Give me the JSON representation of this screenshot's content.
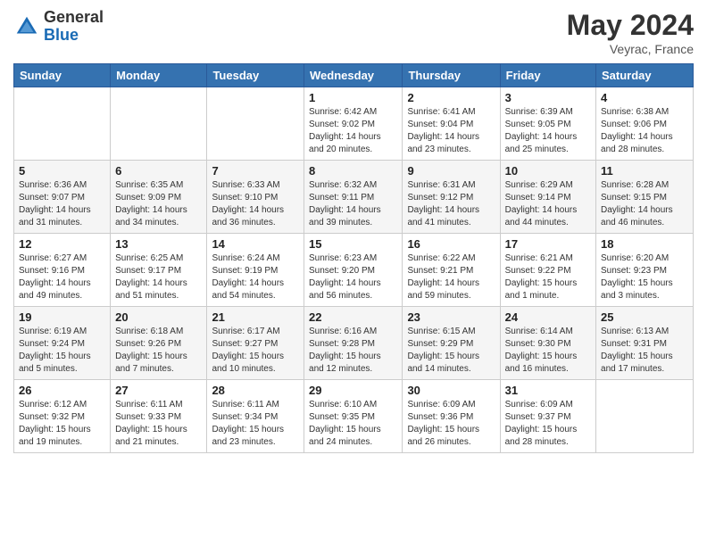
{
  "logo": {
    "general": "General",
    "blue": "Blue"
  },
  "title": {
    "month": "May 2024",
    "location": "Veyrac, France"
  },
  "days_of_week": [
    "Sunday",
    "Monday",
    "Tuesday",
    "Wednesday",
    "Thursday",
    "Friday",
    "Saturday"
  ],
  "weeks": [
    [
      {
        "day": "",
        "info": ""
      },
      {
        "day": "",
        "info": ""
      },
      {
        "day": "",
        "info": ""
      },
      {
        "day": "1",
        "info": "Sunrise: 6:42 AM\nSunset: 9:02 PM\nDaylight: 14 hours\nand 20 minutes."
      },
      {
        "day": "2",
        "info": "Sunrise: 6:41 AM\nSunset: 9:04 PM\nDaylight: 14 hours\nand 23 minutes."
      },
      {
        "day": "3",
        "info": "Sunrise: 6:39 AM\nSunset: 9:05 PM\nDaylight: 14 hours\nand 25 minutes."
      },
      {
        "day": "4",
        "info": "Sunrise: 6:38 AM\nSunset: 9:06 PM\nDaylight: 14 hours\nand 28 minutes."
      }
    ],
    [
      {
        "day": "5",
        "info": "Sunrise: 6:36 AM\nSunset: 9:07 PM\nDaylight: 14 hours\nand 31 minutes."
      },
      {
        "day": "6",
        "info": "Sunrise: 6:35 AM\nSunset: 9:09 PM\nDaylight: 14 hours\nand 34 minutes."
      },
      {
        "day": "7",
        "info": "Sunrise: 6:33 AM\nSunset: 9:10 PM\nDaylight: 14 hours\nand 36 minutes."
      },
      {
        "day": "8",
        "info": "Sunrise: 6:32 AM\nSunset: 9:11 PM\nDaylight: 14 hours\nand 39 minutes."
      },
      {
        "day": "9",
        "info": "Sunrise: 6:31 AM\nSunset: 9:12 PM\nDaylight: 14 hours\nand 41 minutes."
      },
      {
        "day": "10",
        "info": "Sunrise: 6:29 AM\nSunset: 9:14 PM\nDaylight: 14 hours\nand 44 minutes."
      },
      {
        "day": "11",
        "info": "Sunrise: 6:28 AM\nSunset: 9:15 PM\nDaylight: 14 hours\nand 46 minutes."
      }
    ],
    [
      {
        "day": "12",
        "info": "Sunrise: 6:27 AM\nSunset: 9:16 PM\nDaylight: 14 hours\nand 49 minutes."
      },
      {
        "day": "13",
        "info": "Sunrise: 6:25 AM\nSunset: 9:17 PM\nDaylight: 14 hours\nand 51 minutes."
      },
      {
        "day": "14",
        "info": "Sunrise: 6:24 AM\nSunset: 9:19 PM\nDaylight: 14 hours\nand 54 minutes."
      },
      {
        "day": "15",
        "info": "Sunrise: 6:23 AM\nSunset: 9:20 PM\nDaylight: 14 hours\nand 56 minutes."
      },
      {
        "day": "16",
        "info": "Sunrise: 6:22 AM\nSunset: 9:21 PM\nDaylight: 14 hours\nand 59 minutes."
      },
      {
        "day": "17",
        "info": "Sunrise: 6:21 AM\nSunset: 9:22 PM\nDaylight: 15 hours\nand 1 minute."
      },
      {
        "day": "18",
        "info": "Sunrise: 6:20 AM\nSunset: 9:23 PM\nDaylight: 15 hours\nand 3 minutes."
      }
    ],
    [
      {
        "day": "19",
        "info": "Sunrise: 6:19 AM\nSunset: 9:24 PM\nDaylight: 15 hours\nand 5 minutes."
      },
      {
        "day": "20",
        "info": "Sunrise: 6:18 AM\nSunset: 9:26 PM\nDaylight: 15 hours\nand 7 minutes."
      },
      {
        "day": "21",
        "info": "Sunrise: 6:17 AM\nSunset: 9:27 PM\nDaylight: 15 hours\nand 10 minutes."
      },
      {
        "day": "22",
        "info": "Sunrise: 6:16 AM\nSunset: 9:28 PM\nDaylight: 15 hours\nand 12 minutes."
      },
      {
        "day": "23",
        "info": "Sunrise: 6:15 AM\nSunset: 9:29 PM\nDaylight: 15 hours\nand 14 minutes."
      },
      {
        "day": "24",
        "info": "Sunrise: 6:14 AM\nSunset: 9:30 PM\nDaylight: 15 hours\nand 16 minutes."
      },
      {
        "day": "25",
        "info": "Sunrise: 6:13 AM\nSunset: 9:31 PM\nDaylight: 15 hours\nand 17 minutes."
      }
    ],
    [
      {
        "day": "26",
        "info": "Sunrise: 6:12 AM\nSunset: 9:32 PM\nDaylight: 15 hours\nand 19 minutes."
      },
      {
        "day": "27",
        "info": "Sunrise: 6:11 AM\nSunset: 9:33 PM\nDaylight: 15 hours\nand 21 minutes."
      },
      {
        "day": "28",
        "info": "Sunrise: 6:11 AM\nSunset: 9:34 PM\nDaylight: 15 hours\nand 23 minutes."
      },
      {
        "day": "29",
        "info": "Sunrise: 6:10 AM\nSunset: 9:35 PM\nDaylight: 15 hours\nand 24 minutes."
      },
      {
        "day": "30",
        "info": "Sunrise: 6:09 AM\nSunset: 9:36 PM\nDaylight: 15 hours\nand 26 minutes."
      },
      {
        "day": "31",
        "info": "Sunrise: 6:09 AM\nSunset: 9:37 PM\nDaylight: 15 hours\nand 28 minutes."
      },
      {
        "day": "",
        "info": ""
      }
    ]
  ]
}
